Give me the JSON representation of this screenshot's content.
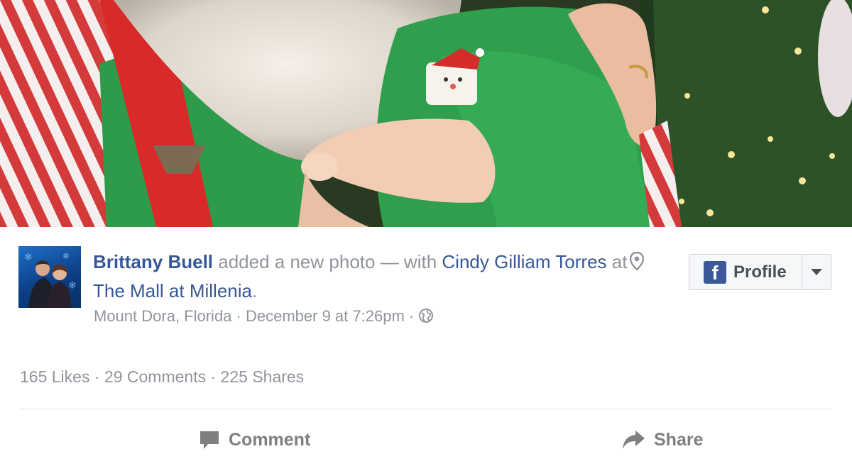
{
  "post": {
    "author": "Brittany Buell",
    "action": "added a new photo",
    "with_label": "with",
    "tagged": "Cindy Gilliam Torres",
    "at_label": "at",
    "place": "The Mall at Millenia",
    "location": "Mount Dora, Florida",
    "time": "December 9 at 7:26pm",
    "privacy_icon": "globe-icon"
  },
  "profile_button": {
    "label": "Profile",
    "icon": "facebook-icon"
  },
  "stats": {
    "likes": "165 Likes",
    "comments": "29 Comments",
    "shares": "225 Shares"
  },
  "actions": {
    "comment": "Comment",
    "share": "Share"
  },
  "colors": {
    "link": "#365899",
    "meta": "#90949c",
    "facebook": "#3b5998"
  }
}
